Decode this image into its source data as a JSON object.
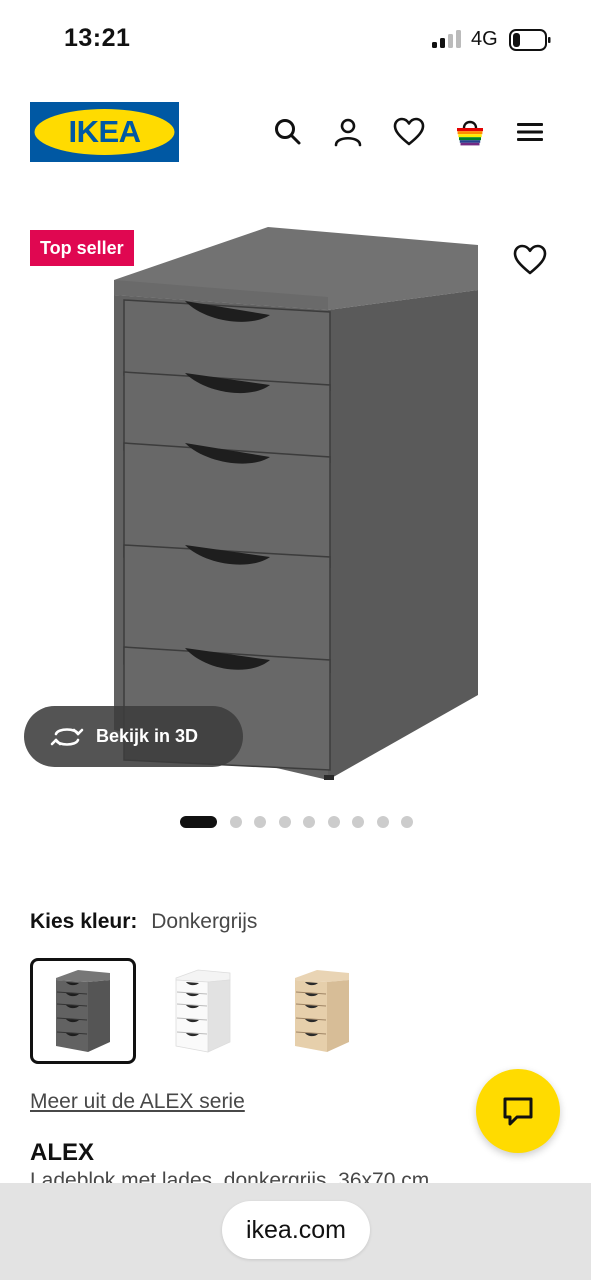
{
  "status_bar": {
    "time": "13:21",
    "network": "4G"
  },
  "header": {
    "logo_text": "IKEA"
  },
  "gallery": {
    "badge": "Top seller",
    "view_3d_label": "Bekijk in 3D",
    "slide_count": 9,
    "active_slide": 1
  },
  "color_picker": {
    "label": "Kies kleur:",
    "selected_value": "Donkergrijs",
    "options": [
      "Donkergrijs",
      "Wit",
      "Eikeneffect wit gelazuurd"
    ]
  },
  "series_link": "Meer uit de ALEX serie",
  "product": {
    "name": "ALEX",
    "description": "Ladeblok met lades, donkergrijs, 36x70 cm"
  },
  "browser": {
    "url": "ikea.com"
  },
  "colors": {
    "brand_blue": "#0058a3",
    "brand_yellow": "#ffdb00",
    "badge_red": "#e00751",
    "product_gray": "#5e5e5e"
  },
  "icons": [
    "search-icon",
    "account-icon",
    "heart-icon",
    "basket-icon",
    "menu-icon",
    "rotate-3d-icon",
    "chat-icon"
  ]
}
